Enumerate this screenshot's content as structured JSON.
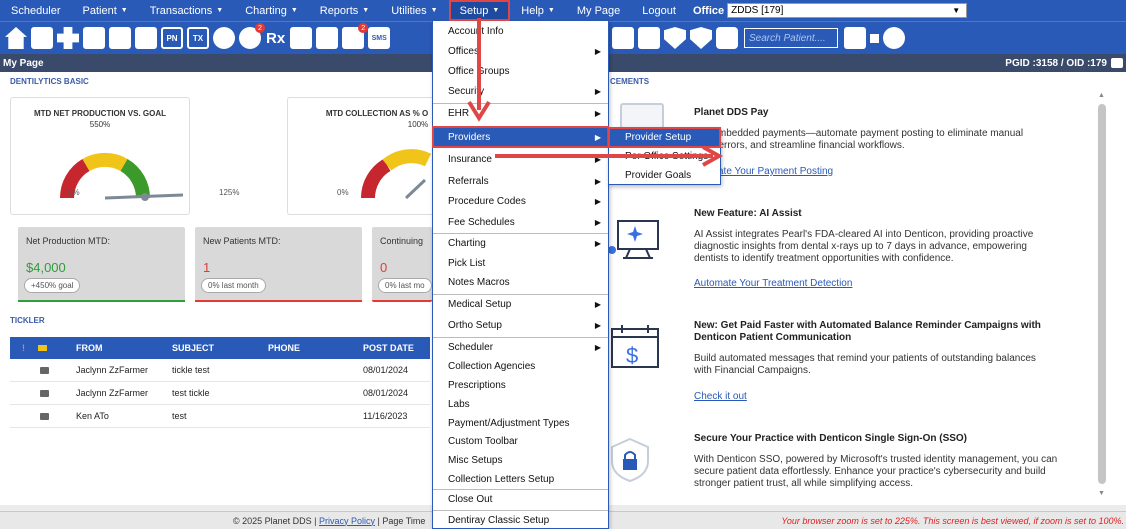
{
  "menubar": {
    "items": [
      {
        "label": "Scheduler",
        "caret": false
      },
      {
        "label": "Patient",
        "caret": true
      },
      {
        "label": "Transactions",
        "caret": true
      },
      {
        "label": "Charting",
        "caret": true
      },
      {
        "label": "Reports",
        "caret": true
      },
      {
        "label": "Utilities",
        "caret": true
      },
      {
        "label": "Setup",
        "caret": true
      },
      {
        "label": "Help",
        "caret": true
      },
      {
        "label": "My Page",
        "caret": false
      },
      {
        "label": "Logout",
        "caret": false
      }
    ],
    "caret_glyph": "▼",
    "office_label": "Office",
    "office_value": "ZDDS [179]"
  },
  "toolbar": {
    "rx": "Rx",
    "pn": "PN",
    "tx": "TX",
    "sms": "SMS",
    "badge_count": "2",
    "search_placeholder": "Search Patient...."
  },
  "pagebar": {
    "title": "My Page",
    "ids": "PGID :3158  /  OID :179"
  },
  "dentilytics": {
    "section_title": "DENTILYTICS BASIC",
    "gauges": [
      {
        "title": "MTD NET PRODUCTION VS. GOAL",
        "pct": "550%",
        "lo": "0%",
        "hi": "125%"
      },
      {
        "title": "MTD COLLECTION AS % O",
        "pct": "100%",
        "lo": "0%",
        "hi": ""
      }
    ],
    "stats": [
      {
        "label": "Net Production MTD:",
        "value": "$4,000",
        "pill": "+450% goal",
        "value_color": "#2e9e3a",
        "bar_color": "#2e9e3a"
      },
      {
        "label": "New Patients MTD:",
        "value": "1",
        "pill": "0% last month",
        "value_color": "#e53935",
        "bar_color": "#e53935"
      },
      {
        "label": "Continuing",
        "value": "0",
        "pill": "0% last mo",
        "value_color": "#e53935",
        "bar_color": "#e53935"
      }
    ]
  },
  "tickler": {
    "section_title": "TICKLER",
    "headers": {
      "flag": "!",
      "from": "FROM",
      "subject": "SUBJECT",
      "phone": "PHONE",
      "post_date": "POST DATE"
    },
    "rows": [
      {
        "from": "Jaclynn ZzFarmer",
        "subject": "tickle test",
        "phone": "",
        "post_date": "08/01/2024"
      },
      {
        "from": "Jaclynn ZzFarmer",
        "subject": "test tickle",
        "phone": "",
        "post_date": "08/01/2024"
      },
      {
        "from": "Ken ATo",
        "subject": "test",
        "phone": "",
        "post_date": "11/16/2023"
      }
    ]
  },
  "announcements": {
    "section_title": "CEMENTS",
    "items": [
      {
        "title": "Planet DDS Pay",
        "body": "ess embedded payments—automate payment posting to eliminate manual\nduce errors, and streamline financial workflows.",
        "link": "ate Your Payment Posting"
      },
      {
        "title": "New Feature: AI Assist",
        "body": "AI Assist integrates Pearl's FDA-cleared AI into Denticon, providing proactive\ndiagnostic insights from dental x-rays up to 7 days in advance, empowering\ndentists to identify treatment opportunities with confidence.",
        "link": "Automate Your Treatment Detection"
      },
      {
        "title": "New: Get Paid Faster with Automated Balance Reminder Campaigns with\nDenticon Patient Communication",
        "body": "Build automated messages that remind your patients of outstanding balances\nwith Financial Campaigns.",
        "link": "Check it out"
      },
      {
        "title": "Secure Your Practice with Denticon Single Sign-On (SSO)",
        "body": "With Denticon SSO, powered by Microsoft's trusted identity management, you can\nsecure patient data effortlessly. Enhance your practice's cybersecurity and build\nstronger patient trust, all while simplifying access.",
        "link": ""
      }
    ]
  },
  "setup_menu": {
    "items": [
      {
        "label": "Account Info",
        "sub": false
      },
      {
        "label": "Offices",
        "sub": true
      },
      {
        "label": "Office Groups",
        "sub": false
      },
      {
        "label": "Security",
        "sub": true
      },
      {
        "label": "EHR",
        "sub": true
      },
      {
        "label": "Providers",
        "sub": true
      },
      {
        "label": "Insurance",
        "sub": true
      },
      {
        "label": "Referrals",
        "sub": true
      },
      {
        "label": "Procedure Codes",
        "sub": true
      },
      {
        "label": "Fee Schedules",
        "sub": true
      },
      {
        "label": "Charting",
        "sub": true
      },
      {
        "label": "Pick List",
        "sub": false
      },
      {
        "label": "Notes Macros",
        "sub": false
      },
      {
        "label": "Medical Setup",
        "sub": true
      },
      {
        "label": "Ortho Setup",
        "sub": true
      },
      {
        "label": "Scheduler",
        "sub": true
      },
      {
        "label": "Collection Agencies",
        "sub": false
      },
      {
        "label": "Prescriptions",
        "sub": false
      },
      {
        "label": "Labs",
        "sub": false
      },
      {
        "label": "Payment/Adjustment Types",
        "sub": false
      },
      {
        "label": "Custom Toolbar",
        "sub": false
      },
      {
        "label": "Misc Setups",
        "sub": false
      },
      {
        "label": "Collection Letters Setup",
        "sub": false
      },
      {
        "label": "Close Out",
        "sub": false
      },
      {
        "label": "Dentiray Classic Setup",
        "sub": false
      }
    ],
    "arrow_glyph": "▶"
  },
  "providers_submenu": {
    "items": [
      "Provider Setup",
      "Per Office Settings",
      "Provider Goals"
    ]
  },
  "footer": {
    "copyright": "© 2025 Planet DDS | ",
    "privacy": "Privacy Policy",
    "page_time": " | Page Time",
    "zoom_warning": "Your browser zoom is set to 225%. This screen is best viewed, if zoom is set to 100%."
  },
  "colors": {
    "brand_blue": "#2a5ab7",
    "highlight_red": "#e04646"
  }
}
